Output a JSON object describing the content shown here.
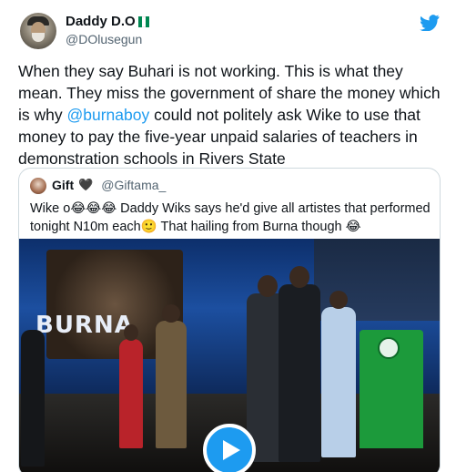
{
  "tweet": {
    "author": {
      "display_name": "Daddy D.O",
      "handle": "@DOlusegun",
      "flag_colors": [
        "#008751",
        "#ffffff",
        "#008751"
      ]
    },
    "text_before_mention": "When they say Buhari is not working. This is what  they mean. They miss the government of share the money which is why ",
    "mention": "@burnaboy",
    "text_after_mention": " could not politely ask Wike to use that money to pay the five-year unpaid salaries of teachers in demonstration schools in Rivers State",
    "brand_color": "#1d9bf0"
  },
  "quoted_tweet": {
    "author": {
      "display_name": "Gift",
      "heart": "🖤",
      "handle": "@Giftama_"
    },
    "text": "Wike o😂😂😂 Daddy Wiks says he'd give all artistes that performed tonight N10m each🙂 That hailing from Burna though 😂",
    "media": {
      "type": "video",
      "overlay_text": "BURNA",
      "play_icon": "play-icon"
    }
  }
}
